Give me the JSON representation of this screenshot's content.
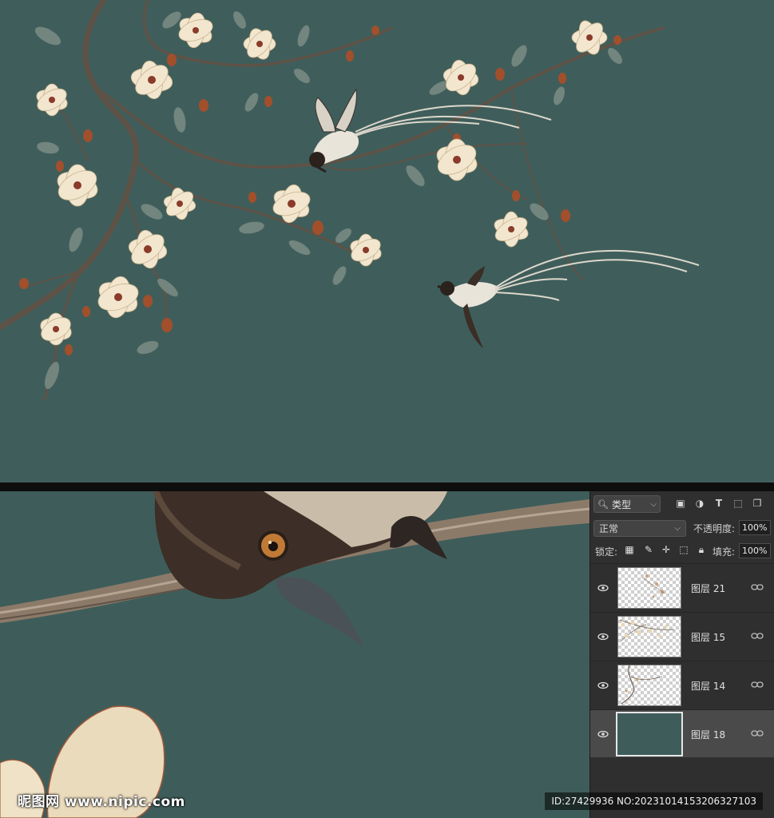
{
  "layers_panel": {
    "filter_kind": "类型",
    "blend_mode": "正常",
    "opacity_label": "不透明度:",
    "opacity_value": "100%",
    "lock_label": "锁定:",
    "fill_label": "填充:",
    "fill_value": "100%",
    "layers": [
      {
        "name": "图层 21",
        "visible": true,
        "selected": false
      },
      {
        "name": "图层 15",
        "visible": true,
        "selected": false
      },
      {
        "name": "图层 14",
        "visible": true,
        "selected": false
      },
      {
        "name": "图层 18",
        "visible": true,
        "selected": true
      }
    ]
  },
  "watermark": {
    "site": "昵图网 www.nipic.com",
    "id_text": "ID:27429936 NO:20231014153206327103"
  },
  "colors": {
    "canvas_background": "#3f5e5b",
    "panel_background": "#2f2f2f",
    "blossom": "#f2e6cf"
  }
}
